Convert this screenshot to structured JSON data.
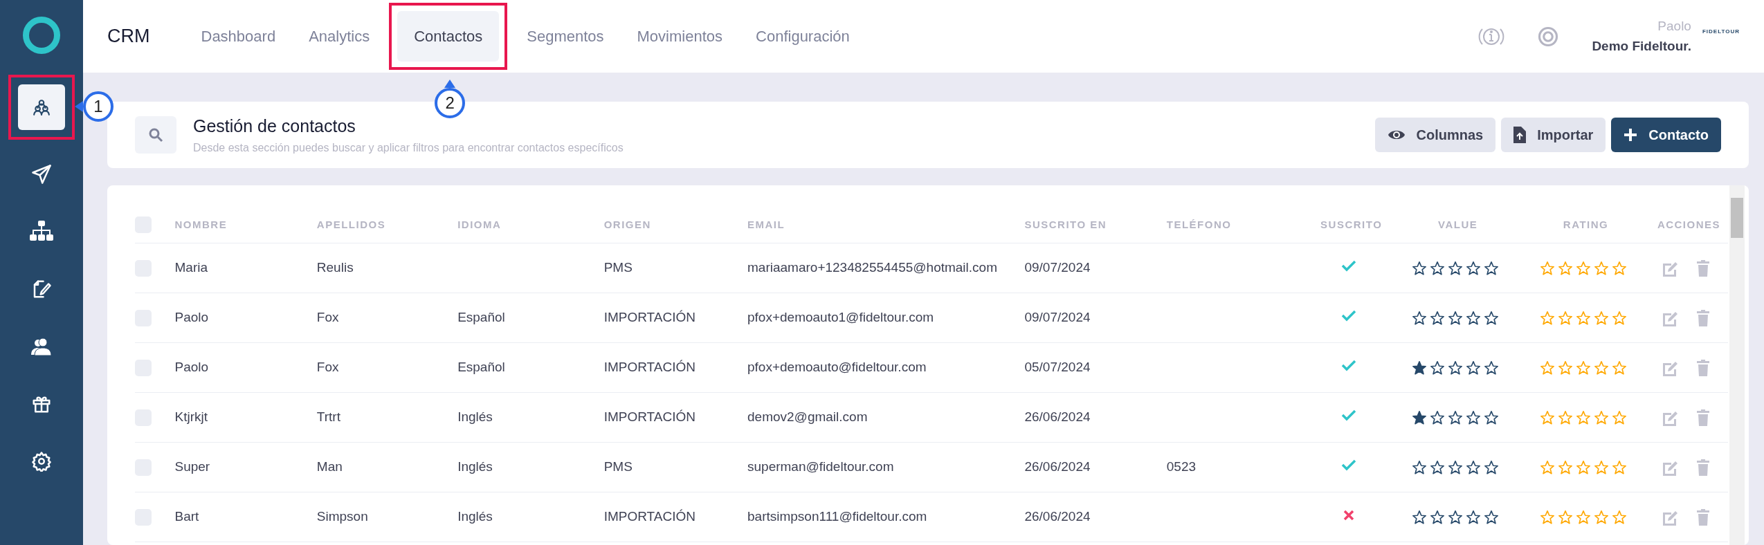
{
  "sidebar": {
    "items": [
      {
        "selected": true,
        "callout": "1"
      },
      {
        "selected": false
      },
      {
        "selected": false
      },
      {
        "selected": false
      },
      {
        "selected": false
      },
      {
        "selected": false
      },
      {
        "selected": false
      }
    ]
  },
  "topbar": {
    "brand": "CRM",
    "tabs": [
      {
        "label": "Dashboard",
        "selected": false
      },
      {
        "label": "Analytics",
        "selected": false
      },
      {
        "label": "Contactos",
        "selected": true,
        "callout": "2"
      },
      {
        "label": "Segmentos",
        "selected": false
      },
      {
        "label": "Movimientos",
        "selected": false
      },
      {
        "label": "Configuración",
        "selected": false
      }
    ],
    "user": {
      "name": "Paolo",
      "company": "Demo Fideltour.",
      "logo": "FIDELTOUR"
    }
  },
  "header": {
    "title": "Gestión de contactos",
    "subtitle": "Desde esta sección puedes buscar y aplicar filtros para encontrar contactos específicos",
    "buttons": [
      {
        "label": "Columnas",
        "kind": "columns"
      },
      {
        "label": "Importar",
        "kind": "import"
      },
      {
        "label": "Contacto",
        "kind": "add"
      }
    ]
  },
  "table": {
    "select_all_checked": false,
    "columns": [
      "NOMBRE",
      "APELLIDOS",
      "IDIOMA",
      "ORIGEN",
      "EMAIL",
      "SUSCRITO EN",
      "TELÉFONO",
      "SUSCRITO",
      "VALUE",
      "RATING",
      "ACCIONES"
    ],
    "rows": [
      {
        "checked": false,
        "nombre": "Maria",
        "apellidos": "Reulis",
        "origen": "PMS",
        "email": "mariaamaro+123482554455@hotmail.com",
        "suscrito_en": "09/07/2024",
        "subscribed": true,
        "value": {
          "stars": 0
        },
        "rating": {
          "stars": 0
        }
      },
      {
        "checked": false,
        "nombre": "Paolo",
        "apellidos": "Fox",
        "idioma": "Español",
        "origen": "IMPORTACIÓN",
        "email": "pfox+demoauto1@fideltour.com",
        "suscrito_en": "09/07/2024",
        "subscribed": true,
        "value": {
          "stars": 0
        },
        "rating": {
          "stars": 0
        }
      },
      {
        "checked": false,
        "nombre": "Paolo",
        "apellidos": "Fox",
        "idioma": "Español",
        "origen": "IMPORTACIÓN",
        "email": "pfox+demoauto@fideltour.com",
        "suscrito_en": "05/07/2024",
        "subscribed": true,
        "value": {
          "stars": 1
        },
        "rating": {
          "stars": 0
        }
      },
      {
        "checked": false,
        "nombre": "Ktjrkjt",
        "apellidos": "Trtrt",
        "idioma": "Inglés",
        "origen": "IMPORTACIÓN",
        "email": "demov2@gmail.com",
        "suscrito_en": "26/06/2024",
        "subscribed": true,
        "value": {
          "stars": 1
        },
        "rating": {
          "stars": 0
        }
      },
      {
        "checked": false,
        "nombre": "Super",
        "apellidos": "Man",
        "idioma": "Inglés",
        "origen": "PMS",
        "email": "superman@fideltour.com",
        "suscrito_en": "26/06/2024",
        "telefono": "0523",
        "subscribed": true,
        "value": {
          "stars": 0
        },
        "rating": {
          "stars": 0
        }
      },
      {
        "checked": false,
        "nombre": "Bart",
        "apellidos": "Simpson",
        "idioma": "Inglés",
        "origen": "IMPORTACIÓN",
        "email": "bartsimpson111@fideltour.com",
        "suscrito_en": "26/06/2024",
        "subscribed": false,
        "value": {
          "stars": 0
        },
        "rating": {
          "stars": 0
        }
      }
    ]
  }
}
